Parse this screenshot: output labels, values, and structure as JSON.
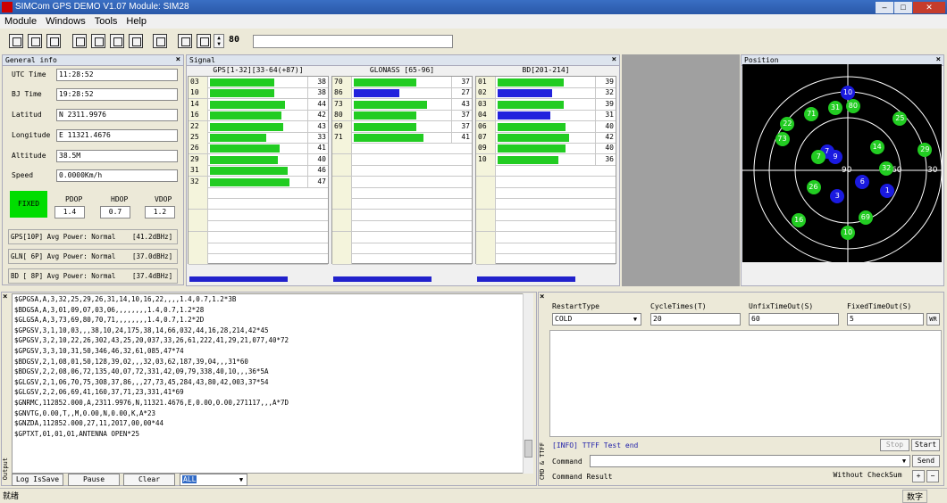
{
  "window": {
    "title": "SIMCom GPS DEMO V1.07  Module: SIM28"
  },
  "menu": [
    "Module",
    "Windows",
    "Tools",
    "Help"
  ],
  "toolbar": {
    "number": "80",
    "text": ""
  },
  "general": {
    "header": "General info",
    "fields": [
      {
        "label": "UTC Time",
        "value": "11:28:52"
      },
      {
        "label": "BJ Time",
        "value": "19:28:52"
      },
      {
        "label": "Latitud",
        "value": "N  2311.9976"
      },
      {
        "label": "Longitude",
        "value": "E  11321.4676"
      },
      {
        "label": "Altitude",
        "value": "38.5M"
      },
      {
        "label": "Speed",
        "value": "0.0000Km/h"
      }
    ],
    "fix": "FIXED",
    "dop_labels": [
      "PDOP",
      "HDOP",
      "VDOP"
    ],
    "dop_values": [
      "1.4",
      "0.7",
      "1.2"
    ],
    "power": [
      {
        "label": "GPS[10P] Avg Power: Normal",
        "value": "[41.2dBHz]"
      },
      {
        "label": "GLN[ 6P] Avg Power: Normal",
        "value": "[37.0dBHz]"
      },
      {
        "label": "BD [ 8P] Avg Power: Normal",
        "value": "[37.4dBHz]"
      }
    ]
  },
  "signal": {
    "header": "Signal",
    "groups": [
      {
        "title": "GPS[1-32][33-64(+87)]",
        "rows": [
          {
            "id": "03",
            "value": "38",
            "color": "#22cc22"
          },
          {
            "id": "10",
            "value": "38",
            "color": "#22cc22"
          },
          {
            "id": "14",
            "value": "44",
            "color": "#22cc22"
          },
          {
            "id": "16",
            "value": "42",
            "color": "#22cc22"
          },
          {
            "id": "22",
            "value": "43",
            "color": "#22cc22"
          },
          {
            "id": "25",
            "value": "33",
            "color": "#22cc22"
          },
          {
            "id": "26",
            "value": "41",
            "color": "#22cc22"
          },
          {
            "id": "29",
            "value": "40",
            "color": "#22cc22"
          },
          {
            "id": "31",
            "value": "46",
            "color": "#22cc22"
          },
          {
            "id": "32",
            "value": "47",
            "color": "#22cc22"
          }
        ]
      },
      {
        "title": "GLONASS [65-96]",
        "rows": [
          {
            "id": "70",
            "value": "37",
            "color": "#22cc22"
          },
          {
            "id": "86",
            "value": "27",
            "color": "#2222dd"
          },
          {
            "id": "73",
            "value": "43",
            "color": "#22cc22"
          },
          {
            "id": "80",
            "value": "37",
            "color": "#22cc22"
          },
          {
            "id": "69",
            "value": "37",
            "color": "#22cc22"
          },
          {
            "id": "71",
            "value": "41",
            "color": "#22cc22"
          }
        ]
      },
      {
        "title": "BD[201-214]",
        "rows": [
          {
            "id": "01",
            "value": "39",
            "color": "#22cc22"
          },
          {
            "id": "02",
            "value": "32",
            "color": "#2222dd"
          },
          {
            "id": "03",
            "value": "39",
            "color": "#22cc22"
          },
          {
            "id": "04",
            "value": "31",
            "color": "#2222dd"
          },
          {
            "id": "06",
            "value": "40",
            "color": "#22cc22"
          },
          {
            "id": "07",
            "value": "42",
            "color": "#22cc22"
          },
          {
            "id": "09",
            "value": "40",
            "color": "#22cc22"
          },
          {
            "id": "10",
            "value": "36",
            "color": "#22cc22"
          }
        ]
      }
    ]
  },
  "position": {
    "header": "Position",
    "labels": [
      "90",
      "60",
      "30"
    ],
    "sats": [
      {
        "id": "10",
        "color": "#1a1ae0",
        "az": 0,
        "el": 75
      },
      {
        "id": "80",
        "color": "#22cc22",
        "az": 5,
        "el": 62
      },
      {
        "id": "71",
        "color": "#22cc22",
        "az": -35,
        "el": 54
      },
      {
        "id": "31",
        "color": "#22cc22",
        "az": -12,
        "el": 60
      },
      {
        "id": "25",
        "color": "#22cc22",
        "az": 50,
        "el": 50
      },
      {
        "id": "22",
        "color": "#22cc22",
        "az": -58,
        "el": 45
      },
      {
        "id": "14",
        "color": "#22cc22",
        "az": 28,
        "el": 22
      },
      {
        "id": "7",
        "color": "#1a1ae0",
        "az": -20,
        "el": 18
      },
      {
        "id": "73",
        "color": "#22cc22",
        "az": -63,
        "el": 30
      },
      {
        "id": "7",
        "color": "#22cc22",
        "az": -28,
        "el": 13
      },
      {
        "id": "9",
        "color": "#1a1ae0",
        "az": -12,
        "el": 13
      },
      {
        "id": "29",
        "color": "#22cc22",
        "az": 74,
        "el": 20
      },
      {
        "id": "32",
        "color": "#22cc22",
        "az": 37,
        "el": 2
      },
      {
        "id": "6",
        "color": "#1a1ae0",
        "az": 14,
        "el": -11
      },
      {
        "id": "26",
        "color": "#22cc22",
        "az": -33,
        "el": -16
      },
      {
        "id": "3",
        "color": "#1a1ae0",
        "az": -10,
        "el": -25
      },
      {
        "id": "1",
        "color": "#1a1ae0",
        "az": 38,
        "el": -20
      },
      {
        "id": "16",
        "color": "#22cc22",
        "az": -47,
        "el": -48
      },
      {
        "id": "69",
        "color": "#22cc22",
        "az": 17,
        "el": -45
      },
      {
        "id": "10",
        "color": "#22cc22",
        "az": 0,
        "el": -60
      }
    ]
  },
  "output": {
    "lines": [
      "$GPGSA,A,3,32,25,29,26,31,14,10,16,22,,,,1.4,0.7,1.2*3B",
      "$BDGSA,A,3,01,09,07,03,06,,,,,,,,1.4,0.7,1.2*28",
      "$GLGSA,A,3,73,69,80,70,71,,,,,,,,1.4,0.7,1.2*2D",
      "$GPGSV,3,1,10,03,,,38,10,24,175,38,14,66,032,44,16,28,214,42*45",
      "$GPGSV,3,2,10,22,26,302,43,25,20,037,33,26,61,222,41,29,21,077,40*72",
      "$GPGSV,3,3,10,31,50,346,46,32,61,085,47*74",
      "$BDGSV,2,1,08,01,50,128,39,02,,,32,03,62,187,39,04,,,31*60",
      "$BDGSV,2,2,08,06,72,135,40,07,72,331,42,09,79,338,40,10,,,36*5A",
      "$GLGSV,2,1,06,70,75,308,37,86,,,27,73,45,284,43,80,42,003,37*54",
      "$GLGSV,2,2,06,69,41,160,37,71,23,331,41*69",
      "$GNRMC,112852.000,A,2311.9976,N,11321.4676,E,0.00,0.00,271117,,,A*7D",
      "$GNVTG,0.00,T,,M,0.00,N,0.00,K,A*23",
      "$GNZDA,112852.000,27,11,2017,00,00*44",
      "$GPTXT,01,01,01,ANTENNA OPEN*25"
    ],
    "side_label": "Output",
    "buttons": [
      "Log IsSave",
      "Pause",
      "Clear"
    ],
    "filter": "ALL"
  },
  "cmd": {
    "side_label": "CMD & TTFF",
    "restart_label": "RestartType",
    "restart_value": "COLD",
    "cycle_label": "CycleTimes(T)",
    "cycle_value": "20",
    "unfix_label": "UnfixTimeOut(S)",
    "unfix_value": "60",
    "fixed_label": "FixedTimeOut(S)",
    "fixed_value": "5",
    "wr": "WR",
    "info": "[INFO] TTFF Test end",
    "stop": "Stop",
    "start": "Start",
    "command_label": "Command",
    "command_value": "",
    "send": "Send",
    "result_label": "Command Result",
    "checksum": "Without CheckSum",
    "plus": "+",
    "minus": "−"
  },
  "status": {
    "left": "就绪",
    "right": "数字"
  }
}
